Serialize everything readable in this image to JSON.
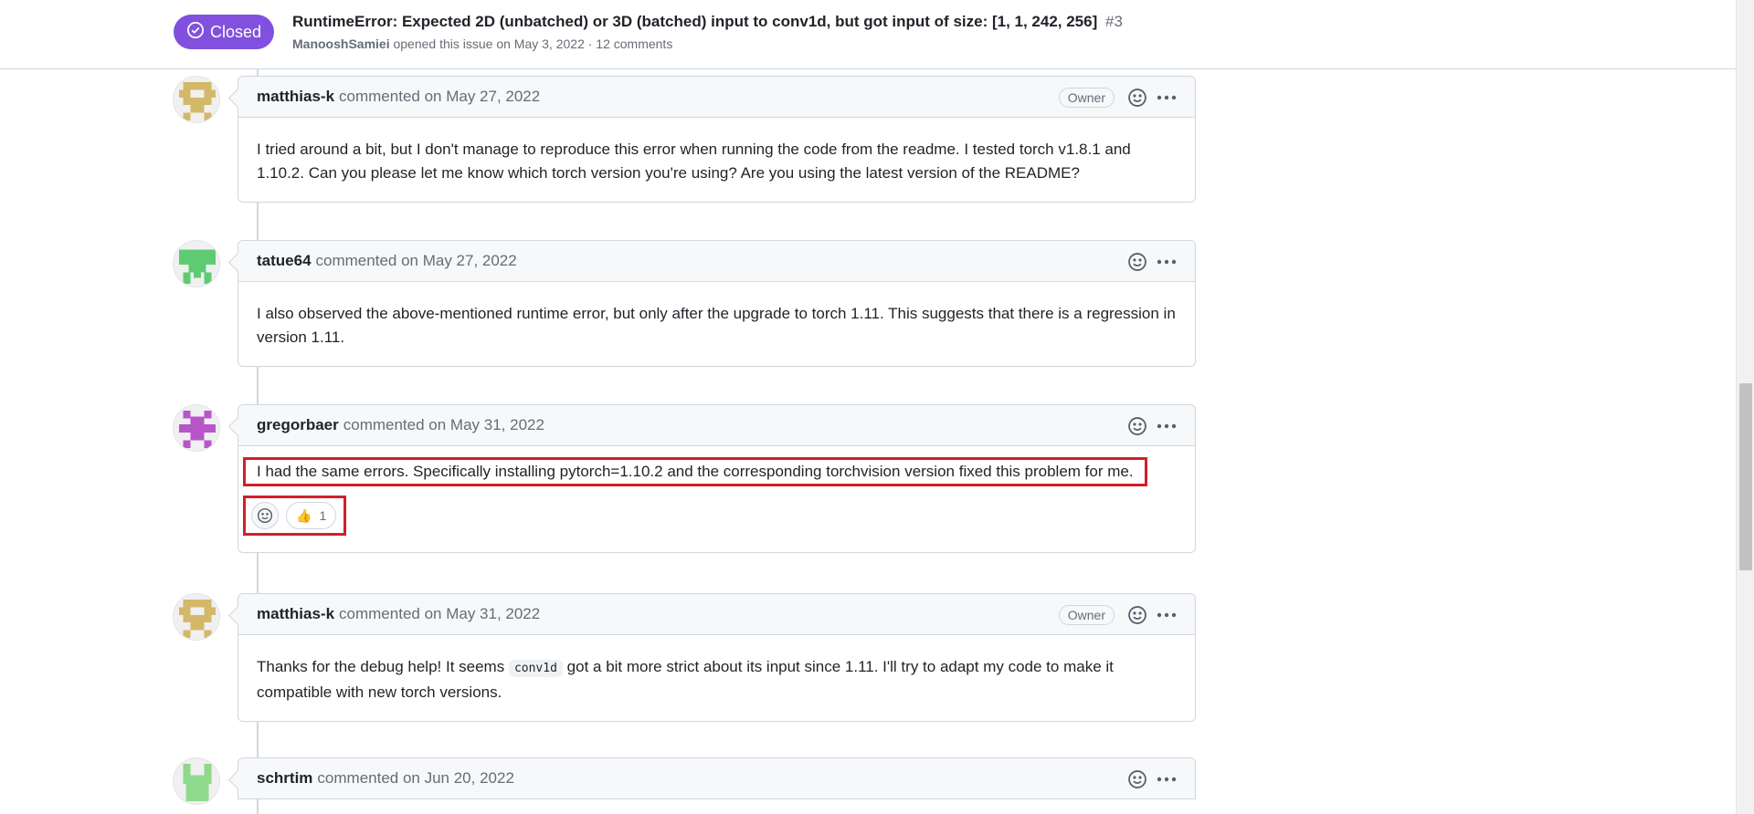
{
  "issue": {
    "state": "Closed",
    "title": "RuntimeError: Expected 2D (unbatched) or 3D (batched) input to conv1d, but got input of size: [1, 1, 242, 256]",
    "number": "#3",
    "author": "ManooshSamiei",
    "meta_rest": "opened this issue on May 3, 2022 · 12 comments"
  },
  "comments": [
    {
      "author": "matthias-k",
      "meta": "commented on May 27, 2022",
      "label": "Owner",
      "body": "I tried around a bit, but I don't manage to reproduce this error when running the code from the readme. I tested torch v1.8.1 and 1.10.2. Can you please let me know which torch version you're using? Are you using the latest version of the README?"
    },
    {
      "author": "tatue64",
      "meta": "commented on May 27, 2022",
      "body": "I also observed the above-mentioned runtime error, but only after the upgrade to torch 1.11. This suggests that there is a regression in version 1.11."
    },
    {
      "author": "gregorbaer",
      "meta": "commented on May 31, 2022",
      "body": "I had the same errors. Specifically installing pytorch=1.10.2 and the corresponding torchvision version fixed this problem for me.",
      "reaction_emoji": "👍",
      "reaction_count": "1"
    },
    {
      "author": "matthias-k",
      "meta": "commented on May 31, 2022",
      "label": "Owner",
      "body_before": "Thanks for the debug help! It seems",
      "body_code": "conv1d",
      "body_after": "got a bit more strict about its input since 1.11. I'll try to adapt my code to make it compatible with new torch versions."
    },
    {
      "author": "schrtim",
      "meta": "commented on Jun 20, 2022"
    }
  ],
  "icons": {
    "state": "check-circle-icon",
    "emoji": "smiley-icon",
    "more": "kebab-horizontal-icon"
  },
  "colors": {
    "closed": "#8250df",
    "highlight": "#d21f2a",
    "avatar_gold": "#d4b86a",
    "avatar_green": "#5ecb73",
    "avatar_purple": "#b855c9",
    "avatar_lightgreen": "#8fd98b"
  }
}
